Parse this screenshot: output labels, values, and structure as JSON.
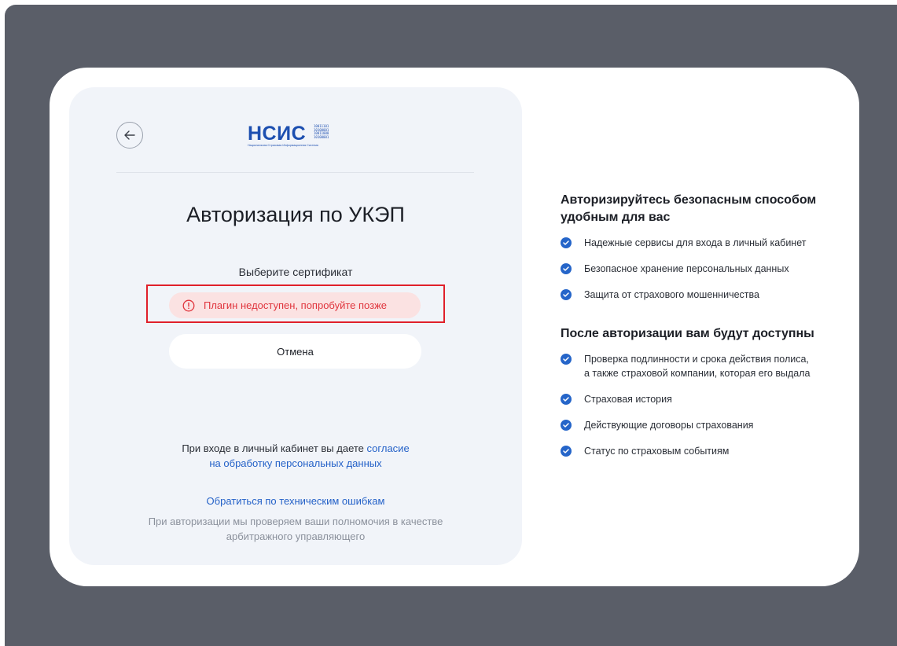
{
  "modal": {
    "logo_text": "НСИС",
    "logo_tagline": "Национальная Страховая Информационная Система",
    "logo_binary": [
      "10011101",
      "10100001",
      "10011000",
      "10100001"
    ],
    "title": "Авторизация по УКЭП",
    "subtitle": "Выберите сертификат",
    "error_message": "Плагин недоступен, попробуйте позже",
    "cancel_label": "Отмена",
    "consent_prefix": "При входе в личный кабинет вы даете ",
    "consent_link_part1": "согласие",
    "consent_link_part2": "на обработку персональных данных",
    "tech_support_link": "Обратиться по техническим ошибкам",
    "note_line1": "При авторизации мы проверяем ваши полномочия в качестве",
    "note_line2": "арбитражного управляющего"
  },
  "benefits": {
    "heading_line1": "Авторизируйтесь безопасным способом",
    "heading_line2": "удобным для вас",
    "items": [
      "Надежные сервисы для входа в личный кабинет",
      "Безопасное хранение персональных данных",
      "Защита от страхового мошенничества"
    ]
  },
  "after_auth": {
    "heading": "После авторизации вам будут доступны",
    "items": [
      {
        "line1": "Проверка подлинности и срока действия полиса,",
        "line2": "а также страховой компании, которая его выдала"
      },
      {
        "line1": "Страховая история"
      },
      {
        "line1": "Действующие договоры страхования"
      },
      {
        "line1": "Статус по страховым событиям"
      }
    ]
  },
  "colors": {
    "backdrop": "#5a5e68",
    "panel": "#f1f4f9",
    "accent": "#2565c9",
    "error_text": "#e0353d",
    "error_bg": "#fbe2e2",
    "highlight_border": "#e0202a"
  }
}
